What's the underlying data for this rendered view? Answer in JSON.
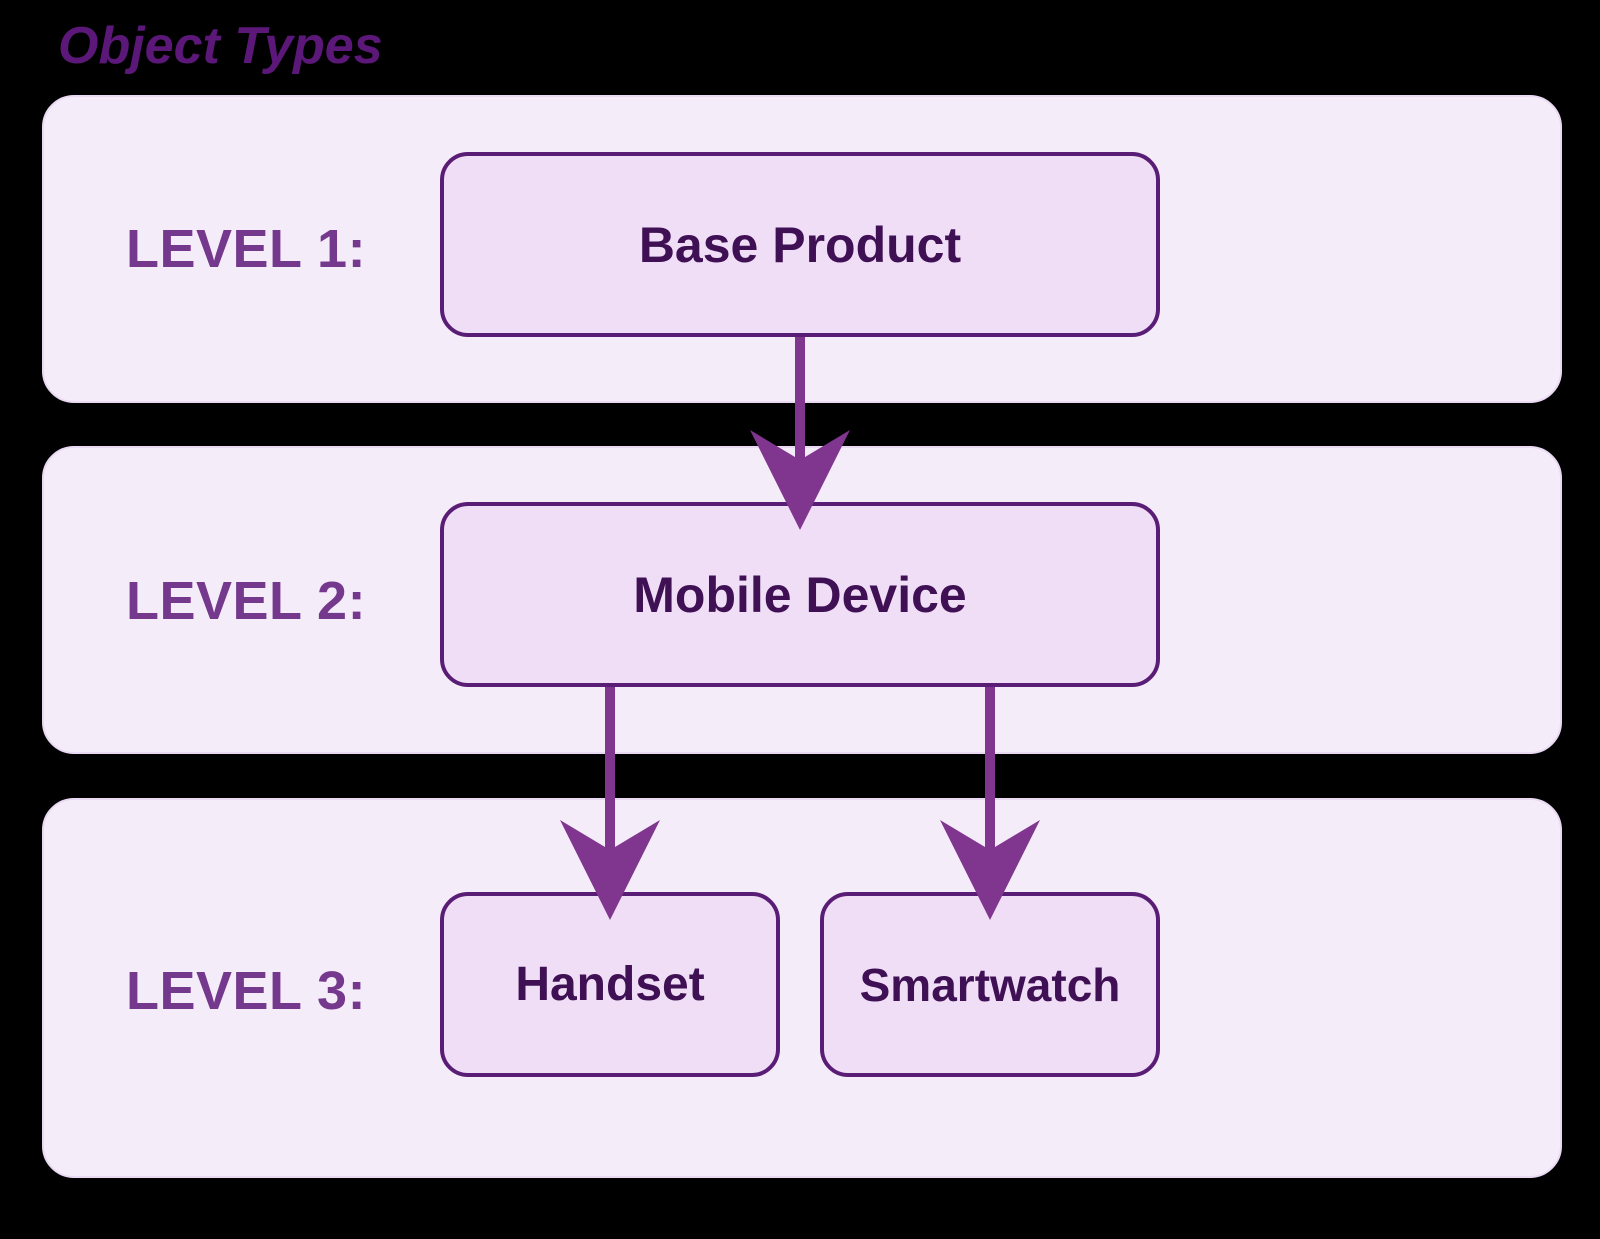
{
  "title": "Object Types",
  "levels": [
    {
      "label": "LEVEL 1:",
      "nodes": [
        "Base Product"
      ]
    },
    {
      "label": "LEVEL 2:",
      "nodes": [
        "Mobile Device"
      ]
    },
    {
      "label": "LEVEL 3:",
      "nodes": [
        "Handset",
        "Smartwatch"
      ]
    }
  ],
  "edges": [
    {
      "from": "Base Product",
      "to": "Mobile Device"
    },
    {
      "from": "Mobile Device",
      "to": "Handset"
    },
    {
      "from": "Mobile Device",
      "to": "Smartwatch"
    }
  ],
  "colors": {
    "accent": "#5a1d75",
    "panel_bg": "#f5ecf9",
    "node_bg": "#f0def7",
    "arrow": "#80358f"
  }
}
